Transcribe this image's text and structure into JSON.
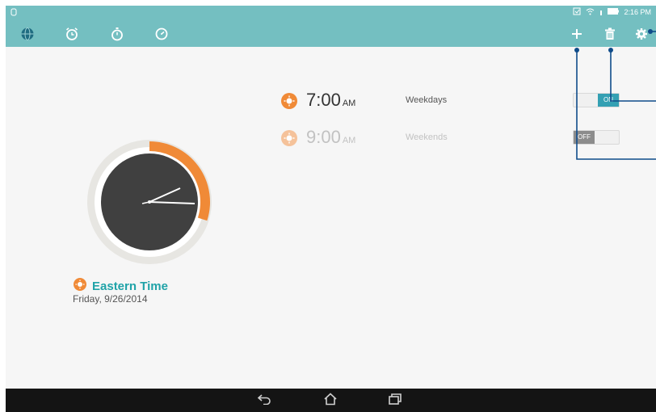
{
  "statusbar": {
    "notification_icon": "notification-dot-icon",
    "time": "2:16 PM"
  },
  "tabs": [
    {
      "name": "world-clock",
      "icon": "globe-icon"
    },
    {
      "name": "alarm",
      "icon": "alarm-clock-icon"
    },
    {
      "name": "stopwatch",
      "icon": "stopwatch-icon"
    },
    {
      "name": "timer",
      "icon": "timer-icon"
    }
  ],
  "actions": [
    {
      "name": "add",
      "icon": "plus-icon"
    },
    {
      "name": "delete",
      "icon": "trash-icon"
    },
    {
      "name": "settings",
      "icon": "gear-icon"
    }
  ],
  "alarms": [
    {
      "time": "7:00",
      "ampm": "AM",
      "days": "Weekdays",
      "state": "ON",
      "enabled": true
    },
    {
      "time": "9:00",
      "ampm": "AM",
      "days": "Weekends",
      "state": "OFF",
      "enabled": false
    }
  ],
  "world_clock": {
    "city": "Eastern Time",
    "date": "Friday, 9/26/2014",
    "day_progress": 0.3
  },
  "colors": {
    "bar": "#74bfc1",
    "accent_orange": "#f08a37",
    "teal_text": "#20a3a8",
    "toggle_on": "#34a0b3",
    "callout_line": "#0f4c8a"
  }
}
